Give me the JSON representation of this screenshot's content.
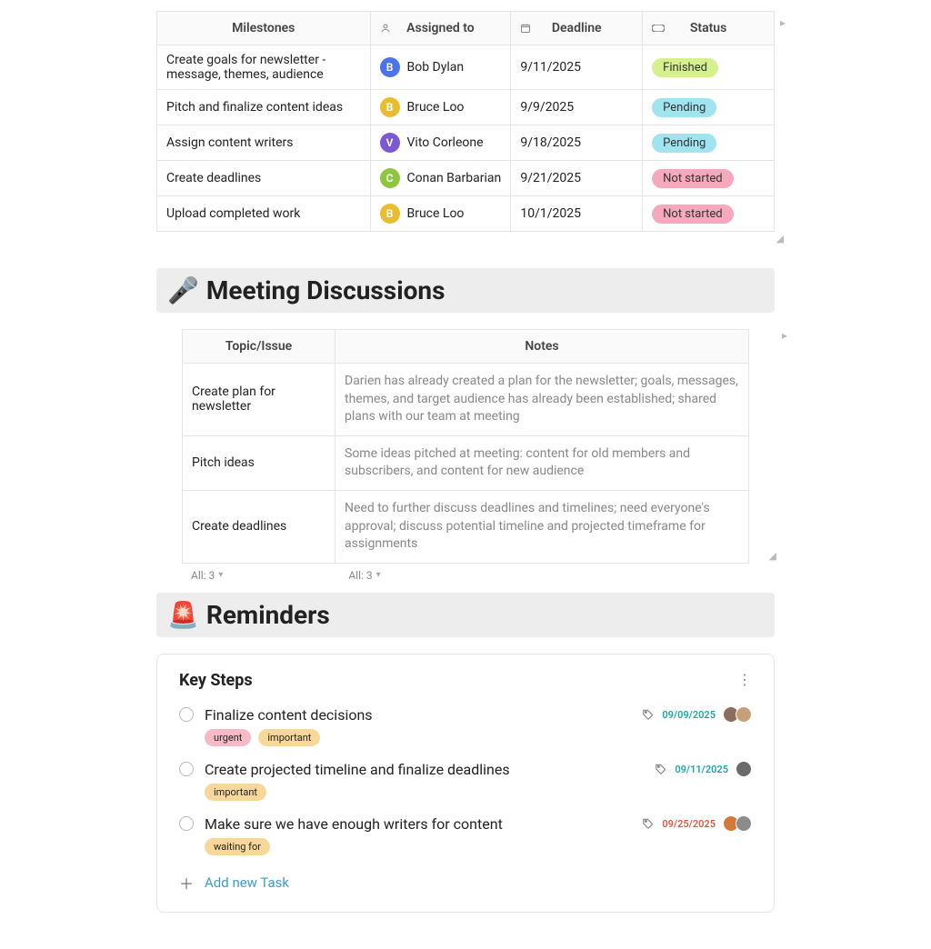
{
  "milestones": {
    "headers": {
      "milestone": "Milestones",
      "assigned": "Assigned to",
      "deadline": "Deadline",
      "status": "Status"
    },
    "rows": [
      {
        "title": "Create goals for newsletter - message, themes, audience",
        "assignee": "Bob Dylan",
        "initial": "B",
        "avatar_bg": "#4a74e8",
        "deadline": "9/11/2025",
        "status": "Finished",
        "status_bg": "#d5f08c"
      },
      {
        "title": "Pitch and finalize content ideas",
        "assignee": "Bruce Loo",
        "initial": "B",
        "avatar_bg": "#e9bd2f",
        "deadline": "9/9/2025",
        "status": "Pending",
        "status_bg": "#9fe4ef"
      },
      {
        "title": "Assign content writers",
        "assignee": "Vito Corleone",
        "initial": "V",
        "avatar_bg": "#7c58d3",
        "deadline": "9/18/2025",
        "status": "Pending",
        "status_bg": "#9fe4ef"
      },
      {
        "title": "Create deadlines",
        "assignee": "Conan Barbarian",
        "initial": "C",
        "avatar_bg": "#8ec63f",
        "deadline": "9/21/2025",
        "status": "Not started",
        "status_bg": "#f6a9bd"
      },
      {
        "title": "Upload completed work",
        "assignee": "Bruce Loo",
        "initial": "B",
        "avatar_bg": "#e9bd2f",
        "deadline": "10/1/2025",
        "status": "Not started",
        "status_bg": "#f6a9bd"
      }
    ]
  },
  "discussions": {
    "heading": "Meeting Discussions",
    "headers": {
      "topic": "Topic/Issue",
      "notes": "Notes"
    },
    "rows": [
      {
        "topic": "Create plan for newsletter",
        "notes": "Darien has already created a plan for the newsletter; goals, messages, themes, and target audience has already been established; shared plans with our team at meeting"
      },
      {
        "topic": "Pitch ideas",
        "notes": "Some ideas pitched at meeting: content for old members and subscribers, and content for new audience"
      },
      {
        "topic": "Create deadlines",
        "notes": "Need to further discuss deadlines and timelines; need everyone's approval; discuss potential timeline and projected timeframe for assignments"
      }
    ],
    "footer_left": "All: 3",
    "footer_right": "All: 3"
  },
  "reminders": {
    "heading": "Reminders",
    "card_title": "Key Steps",
    "tasks": [
      {
        "title": "Finalize content decisions",
        "date": "09/09/2025",
        "date_color": "#1aa8a8",
        "tags": [
          {
            "label": "urgent",
            "bg": "#f6b9c6"
          },
          {
            "label": "important",
            "bg": "#f7d89a"
          }
        ],
        "avatars": [
          "#8a6d5b",
          "#c7a07a"
        ]
      },
      {
        "title": "Create projected timeline and finalize deadlines",
        "date": "09/11/2025",
        "date_color": "#1aa8a8",
        "tags": [
          {
            "label": "important",
            "bg": "#f7d89a"
          }
        ],
        "avatars": [
          "#6b6b6b"
        ]
      },
      {
        "title": "Make sure we have enough writers for content",
        "date": "09/25/2025",
        "date_color": "#e0593f",
        "tags": [
          {
            "label": "waiting for",
            "bg": "#f7d89a"
          }
        ],
        "avatars": [
          "#d4793a",
          "#8c8c8c"
        ]
      }
    ],
    "add_task": "Add new Task"
  }
}
